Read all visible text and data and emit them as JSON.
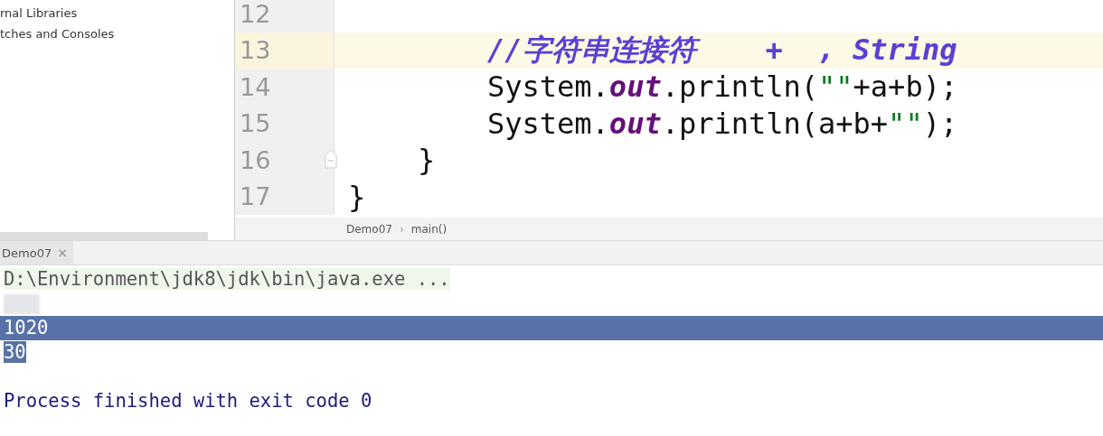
{
  "project_tree": {
    "items": [
      {
        "label": "rnal Libraries"
      },
      {
        "label": "tches and Consoles"
      }
    ]
  },
  "editor": {
    "lines": [
      {
        "number": "12",
        "current": false
      },
      {
        "number": "13",
        "current": true,
        "kind": "body",
        "tokens": [
          {
            "text": "//字符串连接符    +  , String",
            "kind": "comment"
          }
        ]
      },
      {
        "number": "14",
        "current": false,
        "kind": "body",
        "tokens": [
          {
            "text": "System.",
            "kind": "plain"
          },
          {
            "text": "out",
            "kind": "field"
          },
          {
            "text": ".println(",
            "kind": "plain"
          },
          {
            "text": "\"\"",
            "kind": "string"
          },
          {
            "text": "+a+b);",
            "kind": "plain"
          }
        ]
      },
      {
        "number": "15",
        "current": false,
        "kind": "body",
        "tokens": [
          {
            "text": "System.",
            "kind": "plain"
          },
          {
            "text": "out",
            "kind": "field"
          },
          {
            "text": ".println(a+b+",
            "kind": "plain"
          },
          {
            "text": "\"\"",
            "kind": "string"
          },
          {
            "text": ");",
            "kind": "plain"
          }
        ]
      },
      {
        "number": "16",
        "current": false,
        "fold": true,
        "kind": "method",
        "tokens": [
          {
            "text": "}",
            "kind": "plain"
          }
        ]
      },
      {
        "number": "17",
        "current": false,
        "kind": "class",
        "tokens": [
          {
            "text": "}",
            "kind": "plain"
          }
        ]
      }
    ],
    "breadcrumbs": [
      "Demo07",
      "main()"
    ],
    "breadcrumb_separator": "›"
  },
  "run_panel": {
    "tabs": [
      {
        "label": "Demo07",
        "close": "×",
        "selected": true
      }
    ],
    "lines": [
      {
        "kind": "command",
        "text": "D:\\Environment\\jdk8\\jdk\\bin\\java.exe ...",
        "selected": false
      },
      {
        "kind": "redacted",
        "selected": false
      },
      {
        "kind": "output",
        "text": "1020",
        "selected": true
      },
      {
        "kind": "output",
        "text": "30",
        "selected": true
      },
      {
        "kind": "blank",
        "selected": false
      },
      {
        "kind": "finished",
        "text": "Process finished with exit code 0",
        "selected": false
      }
    ]
  }
}
